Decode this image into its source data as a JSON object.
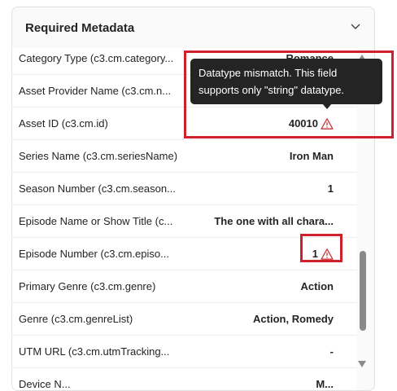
{
  "panel": {
    "title": "Required Metadata",
    "chevron_icon": "chevron-down-icon"
  },
  "rows": [
    {
      "label": "Category Type (c3.cm.category...",
      "value": "Romance"
    },
    {
      "label": "Asset Provider Name (c3.cm.n...",
      "value": ""
    },
    {
      "label": "Asset ID (c3.cm.id)",
      "value": "40010"
    },
    {
      "label": "Series Name (c3.cm.seriesName)",
      "value": "Iron Man"
    },
    {
      "label": "Season Number (c3.cm.season...",
      "value": "1"
    },
    {
      "label": "Episode Name or Show Title (c...",
      "value": "The one with all chara..."
    },
    {
      "label": "Episode Number (c3.cm.episo...",
      "value": "1"
    },
    {
      "label": "Primary Genre (c3.cm.genre)",
      "value": "Action"
    },
    {
      "label": "Genre (c3.cm.genreList)",
      "value": "Action, Romedy"
    },
    {
      "label": "UTM URL (c3.cm.utmTracking...",
      "value": "-"
    },
    {
      "label": "Device N...",
      "value": "M..."
    }
  ],
  "tooltip": {
    "text": "Datatype mismatch. This field supports only \"string\" datatype."
  },
  "colors": {
    "warning": "#d13438",
    "highlight": "#d0202b",
    "tooltip_bg": "#242424"
  }
}
